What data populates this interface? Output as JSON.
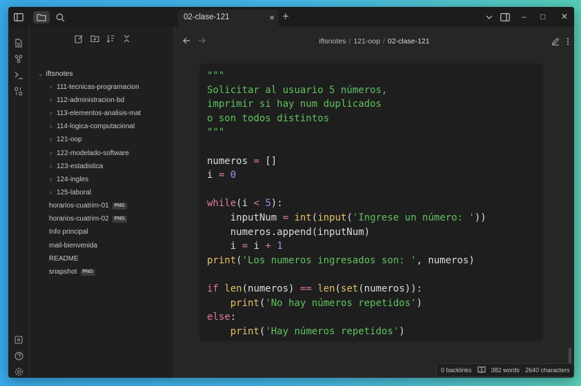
{
  "tab": {
    "title": "02-clase-121",
    "close": "×",
    "new": "+"
  },
  "window_controls": {
    "minimize": "–",
    "maximize": "□",
    "close": "✕"
  },
  "sidebar": {
    "vault": "iftsnotes",
    "folders": [
      "111-tecnicas-programacion",
      "112-administracion-bd",
      "113-elementos-analisis-mat",
      "114-logica-computacional",
      "121-oop",
      "122-modelado-software",
      "123-estadistica",
      "124-ingles",
      "125-laboral"
    ],
    "files": [
      {
        "name": "horarios-cuatrim-01",
        "badge": "PNG"
      },
      {
        "name": "horarios-cuatrim-02",
        "badge": "PNG"
      },
      {
        "name": "Info principal",
        "badge": ""
      },
      {
        "name": "mail-bienvenida",
        "badge": ""
      },
      {
        "name": "README",
        "badge": ""
      },
      {
        "name": "snapshot",
        "badge": "PNG"
      }
    ]
  },
  "breadcrumb": {
    "vault": "iftsnotes",
    "folder": "121-oop",
    "note": "02-clase-121",
    "sep": "/"
  },
  "code": [
    [
      [
        "str",
        "\"\"\""
      ]
    ],
    [
      [
        "str",
        "Solicitar al usuario 5 números,"
      ]
    ],
    [
      [
        "str",
        "imprimir si hay num duplicados"
      ]
    ],
    [
      [
        "str",
        "o son todos distintos"
      ]
    ],
    [
      [
        "str",
        "\"\"\""
      ]
    ],
    [],
    [
      [
        "txt",
        "numeros "
      ],
      [
        "op",
        "="
      ],
      [
        "txt",
        " []"
      ]
    ],
    [
      [
        "txt",
        "i "
      ],
      [
        "op",
        "="
      ],
      [
        "txt",
        " "
      ],
      [
        "num",
        "0"
      ]
    ],
    [],
    [
      [
        "kw",
        "while"
      ],
      [
        "txt",
        "(i "
      ],
      [
        "op",
        "<"
      ],
      [
        "txt",
        " "
      ],
      [
        "num",
        "5"
      ],
      [
        "txt",
        "):"
      ]
    ],
    [
      [
        "txt",
        "    inputNum "
      ],
      [
        "op",
        "="
      ],
      [
        "txt",
        " "
      ],
      [
        "fn",
        "int"
      ],
      [
        "txt",
        "("
      ],
      [
        "fn",
        "input"
      ],
      [
        "txt",
        "("
      ],
      [
        "str",
        "'Ingrese un número: '"
      ],
      [
        "txt",
        "))"
      ]
    ],
    [
      [
        "txt",
        "    numeros.append(inputNum)"
      ]
    ],
    [
      [
        "txt",
        "    i "
      ],
      [
        "op",
        "="
      ],
      [
        "txt",
        " i "
      ],
      [
        "op",
        "+"
      ],
      [
        "txt",
        " "
      ],
      [
        "num",
        "1"
      ]
    ],
    [
      [
        "fn",
        "print"
      ],
      [
        "txt",
        "("
      ],
      [
        "str",
        "'Los numeros ingresados son: '"
      ],
      [
        "txt",
        ", numeros)"
      ]
    ],
    [],
    [
      [
        "kw",
        "if"
      ],
      [
        "txt",
        " "
      ],
      [
        "fn",
        "len"
      ],
      [
        "txt",
        "(numeros) "
      ],
      [
        "op",
        "=="
      ],
      [
        "txt",
        " "
      ],
      [
        "fn",
        "len"
      ],
      [
        "txt",
        "("
      ],
      [
        "fn",
        "set"
      ],
      [
        "txt",
        "(numeros)):"
      ]
    ],
    [
      [
        "txt",
        "    "
      ],
      [
        "fn",
        "print"
      ],
      [
        "txt",
        "("
      ],
      [
        "str",
        "'No hay números repetidos'"
      ],
      [
        "txt",
        ")"
      ]
    ],
    [
      [
        "kw",
        "else"
      ],
      [
        "txt",
        ":"
      ]
    ],
    [
      [
        "txt",
        "    "
      ],
      [
        "fn",
        "print"
      ],
      [
        "txt",
        "("
      ],
      [
        "str",
        "'Hay números repetidos'"
      ],
      [
        "txt",
        ")"
      ]
    ]
  ],
  "status": {
    "backlinks": "0 backlinks",
    "words": "382 words",
    "characters": "2640 characters"
  },
  "colors": {
    "string": "#5fc25f",
    "keyword": "#e07a9c",
    "function": "#e6c069",
    "number": "#a68cf0"
  }
}
